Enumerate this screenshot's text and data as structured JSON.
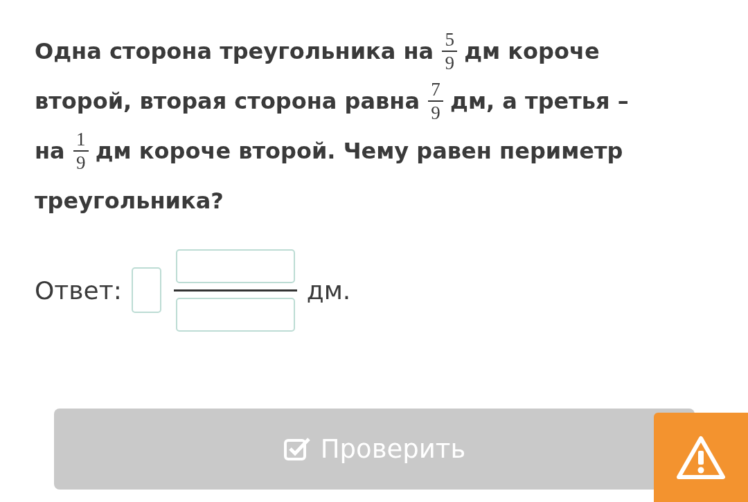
{
  "question": [
    [
      {
        "kind": "text",
        "text": "Одна сторона треугольника на"
      },
      {
        "kind": "fraction",
        "numerator": "5",
        "denominator": "9"
      },
      {
        "kind": "text",
        "text": "дм короче"
      }
    ],
    [
      {
        "kind": "text",
        "text": "второй, вторая сторона равна"
      },
      {
        "kind": "fraction",
        "numerator": "7",
        "denominator": "9"
      },
      {
        "kind": "text",
        "text": "дм, а третья –"
      }
    ],
    [
      {
        "kind": "text",
        "text": "на"
      },
      {
        "kind": "fraction",
        "numerator": "1",
        "denominator": "9"
      },
      {
        "kind": "text",
        "text": "дм короче второй. Чему равен периметр"
      }
    ],
    [
      {
        "kind": "text",
        "text": "треугольника?"
      }
    ]
  ],
  "answer": {
    "label": "Ответ:",
    "unit": "дм."
  },
  "check_button": {
    "label": "Проверить",
    "disabled": true
  }
}
